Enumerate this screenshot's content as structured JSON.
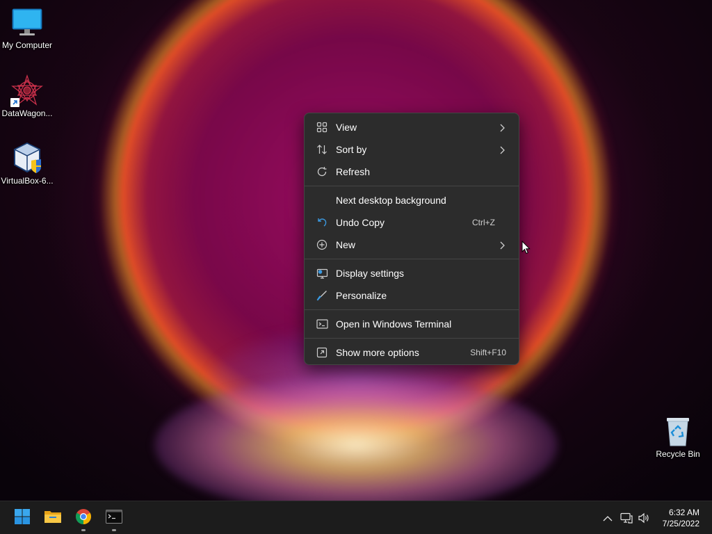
{
  "desktop": {
    "icons": [
      {
        "label": "My Computer",
        "icon": "computer-icon"
      },
      {
        "label": "DataWagon...",
        "icon": "datawagon-icon"
      },
      {
        "label": "VirtualBox-6...",
        "icon": "virtualbox-icon"
      },
      {
        "label": "Recycle Bin",
        "icon": "recycle-bin-icon"
      }
    ]
  },
  "context_menu": {
    "items": [
      {
        "label": "View",
        "icon": "view-grid-icon",
        "submenu": true
      },
      {
        "label": "Sort by",
        "icon": "sort-icon",
        "submenu": true
      },
      {
        "label": "Refresh",
        "icon": "refresh-icon"
      },
      {
        "label": "Next desktop background",
        "icon": ""
      },
      {
        "label": "Undo Copy",
        "icon": "undo-icon",
        "shortcut": "Ctrl+Z"
      },
      {
        "label": "New",
        "icon": "new-plus-icon",
        "submenu": true
      },
      {
        "label": "Display settings",
        "icon": "display-settings-icon"
      },
      {
        "label": "Personalize",
        "icon": "personalize-brush-icon"
      },
      {
        "label": "Open in Windows Terminal",
        "icon": "terminal-icon"
      },
      {
        "label": "Show more options",
        "icon": "show-more-options-icon",
        "shortcut": "Shift+F10"
      }
    ]
  },
  "taskbar": {
    "apps": [
      {
        "name": "Start",
        "icon": "windows-start-icon"
      },
      {
        "name": "File Explorer",
        "icon": "file-explorer-icon"
      },
      {
        "name": "Google Chrome",
        "icon": "chrome-icon"
      },
      {
        "name": "Terminal",
        "icon": "terminal-app-icon"
      }
    ],
    "tray": {
      "icons": [
        "chevron-up-icon",
        "network-icon",
        "volume-icon"
      ],
      "time": "6:32 AM",
      "date": "7/25/2022"
    }
  },
  "colors": {
    "menu_bg": "#2c2c2c",
    "taskbar_bg": "#1c1c1c",
    "accent_blue": "#3b9ae1"
  }
}
